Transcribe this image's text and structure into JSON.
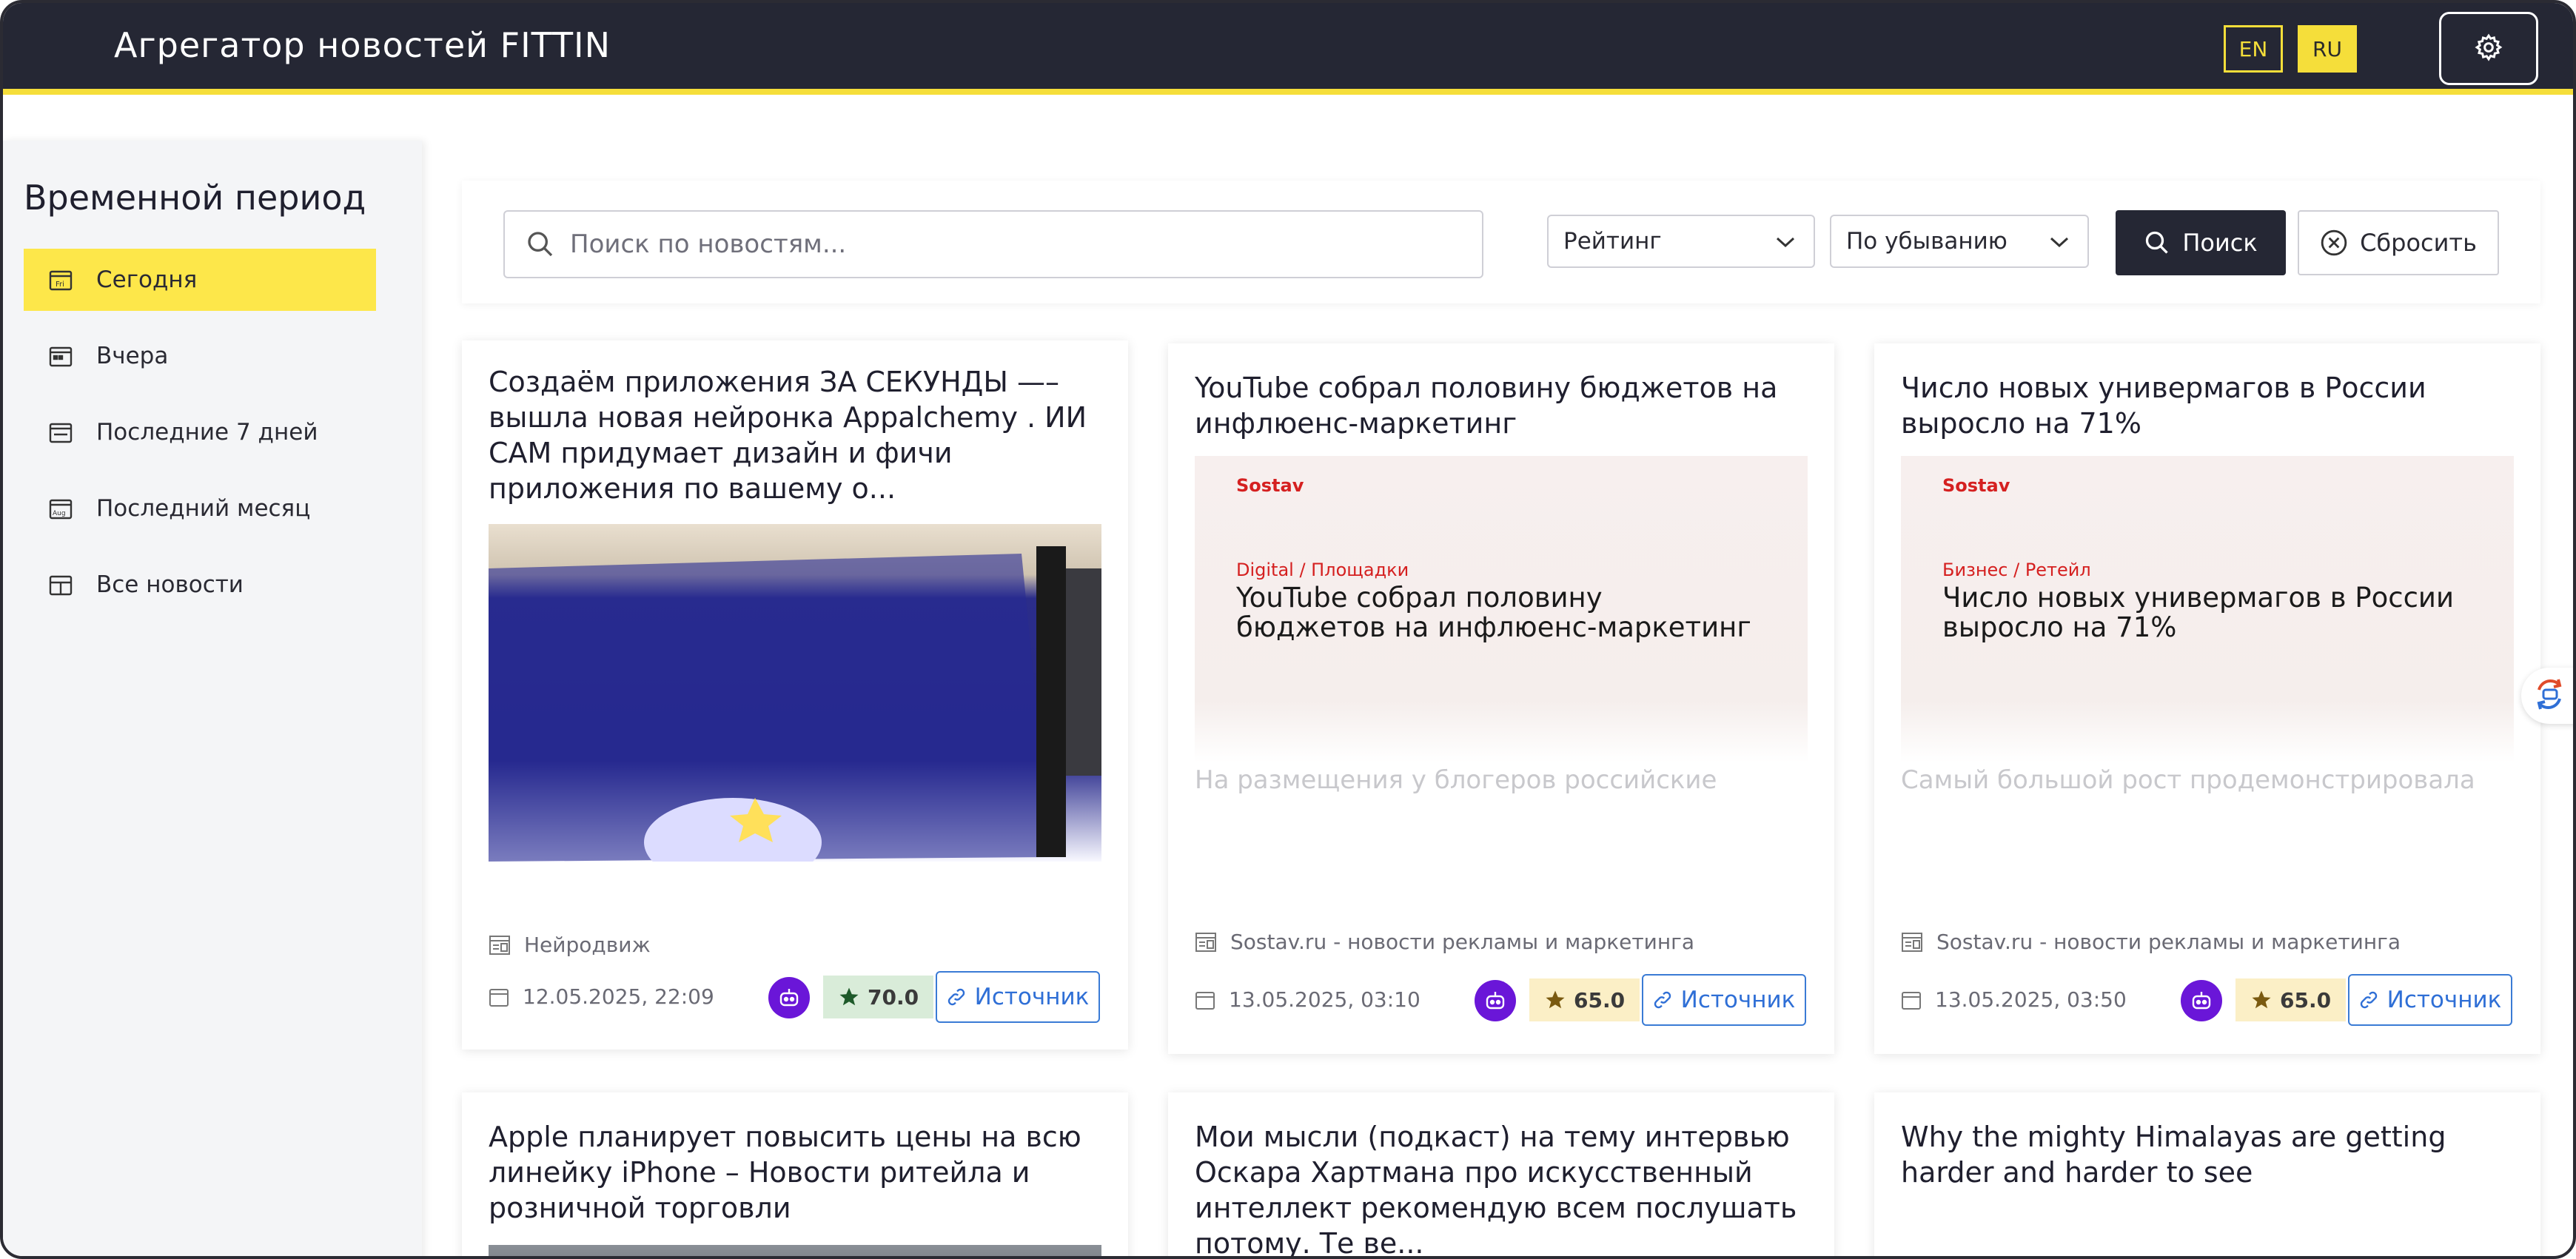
{
  "header": {
    "title": "Агрегатор новостей FITTIN",
    "lang_en": "EN",
    "lang_ru": "RU",
    "settings_icon": "gear-icon"
  },
  "sidebar": {
    "title": "Временной период",
    "items": [
      {
        "label": "Сегодня",
        "icon": "calendar-today-icon",
        "active": true
      },
      {
        "label": "Вчера",
        "icon": "calendar-icon"
      },
      {
        "label": "Последние 7 дней",
        "icon": "calendar-week-icon"
      },
      {
        "label": "Последний месяц",
        "icon": "calendar-month-icon"
      },
      {
        "label": "Все новости",
        "icon": "calendar-all-icon"
      }
    ]
  },
  "search": {
    "placeholder": "Поиск по новостям...",
    "sort_field": "Рейтинг",
    "sort_order": "По убыванию",
    "search_label": "Поиск",
    "reset_label": "Сбросить"
  },
  "cards": [
    {
      "title": "Создаём приложения ЗА СЕКУНДЫ —– вышла новая нейронка Appalchemy . ИИ САМ придумает дизайн и фичи приложения по вашему о...",
      "source": "Нейродвиж",
      "date": "12.05.2025, 22:09",
      "score": "70.0",
      "source_link": "Источник"
    },
    {
      "title": "YouTube собрал половину бюджетов на инфлюенс-маркетинг",
      "image_logo": "Sostav",
      "image_category": "Digital / Площадки",
      "image_headline": "YouTube собрал половину бюджетов на инфлюенс-маркетинг",
      "excerpt": "На размещения у блогеров российские",
      "source": "Sostav.ru - новости рекламы и маркетинга",
      "date": "13.05.2025, 03:10",
      "score": "65.0",
      "source_link": "Источник"
    },
    {
      "title": "Число новых универмагов в России выросло на 71%",
      "image_logo": "Sostav",
      "image_category": "Бизнес / Ретейл",
      "image_headline": "Число новых универмагов в России выросло на 71%",
      "excerpt": "Самый большой рост продемонстрировала",
      "source": "Sostav.ru - новости рекламы и маркетинга",
      "date": "13.05.2025, 03:50",
      "score": "65.0",
      "source_link": "Источник"
    },
    {
      "title": "Apple планирует повысить цены на всю линейку iPhone – Новости ритейла и розничной торговли"
    },
    {
      "title": "Мои мысли (подкаст) на тему интервью Оскара Хартмана про искусственный интеллект рекомендую всем послушать потому. Те ве..."
    },
    {
      "title": "Why the mighty Himalayas are getting harder and harder to see"
    }
  ],
  "colors": {
    "header_bg": "#252734",
    "accent": "#f5de3a",
    "link": "#2f6fd6",
    "ai_badge": "#6a16d8"
  }
}
